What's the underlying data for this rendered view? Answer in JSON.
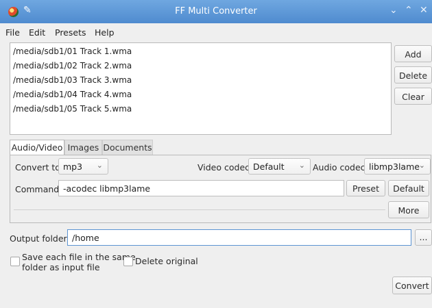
{
  "window": {
    "title": "FF Multi Converter",
    "controls": [
      "minimize-icon",
      "maximize-icon",
      "close-icon"
    ]
  },
  "menu": [
    "File",
    "Edit",
    "Presets",
    "Help"
  ],
  "files": [
    "/media/sdb1/01 Track 1.wma",
    "/media/sdb1/02 Track 2.wma",
    "/media/sdb1/03 Track 3.wma",
    "/media/sdb1/04 Track 4.wma",
    "/media/sdb1/05 Track 5.wma"
  ],
  "list_buttons": {
    "add": "Add",
    "delete": "Delete",
    "clear": "Clear"
  },
  "tabs": [
    "Audio/Video",
    "Images",
    "Documents"
  ],
  "audio_video": {
    "convert_to_label": "Convert to:",
    "convert_to_value": "mp3",
    "video_codec_label": "Video codec:",
    "video_codec_value": "Default",
    "audio_codec_label": "Audio codec:",
    "audio_codec_value": "libmp3lame",
    "command_label": "Command:",
    "command_value": "-acodec libmp3lame",
    "preset_button": "Preset",
    "default_button": "Default",
    "more_button": "More"
  },
  "output": {
    "label": "Output folder:",
    "value": "/home",
    "browse_button": "..."
  },
  "options": {
    "save_same_folder_line1": "Save each file in the same",
    "save_same_folder_line2": "folder as input file",
    "delete_original": "Delete original"
  },
  "convert_button": "Convert",
  "colors": {
    "titlebar": "#4f8bcf",
    "focus_border": "#5b93d2"
  }
}
